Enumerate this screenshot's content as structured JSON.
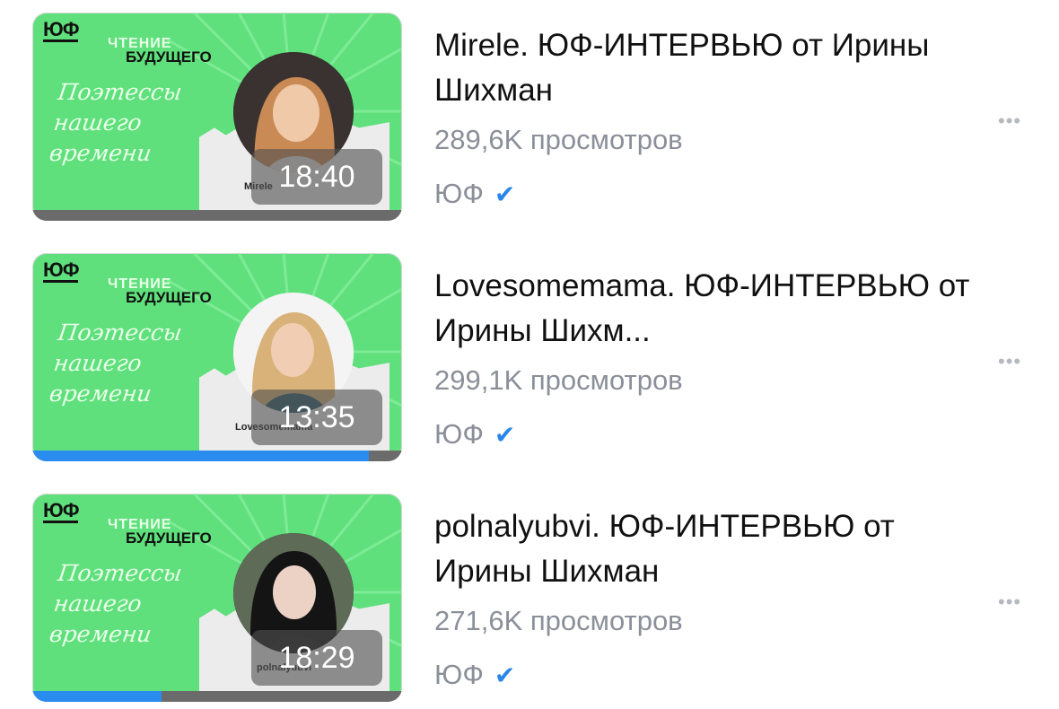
{
  "videos": [
    {
      "thumb": {
        "logo": "ЮФ",
        "header_line1": "ЧТЕНИЕ",
        "header_line2": "БУДУЩЕГО",
        "script_lines": [
          "Поэтессы",
          "нашего",
          "времени"
        ],
        "caption": "Mirele",
        "duration": "18:40",
        "progress": 0.0
      },
      "title": "Mirele. ЮФ-ИНТЕРВЬЮ от Ирины Шихман",
      "views": "289,6K просмотров",
      "channel": "ЮФ",
      "verified_icon": "checkmark-icon",
      "more_label": "•••"
    },
    {
      "thumb": {
        "logo": "ЮФ",
        "header_line1": "ЧТЕНИЕ",
        "header_line2": "БУДУЩЕГО",
        "script_lines": [
          "Поэтессы",
          "нашего",
          "времени"
        ],
        "caption": "Lovesomemama",
        "duration": "13:35",
        "progress": 0.91
      },
      "title": "Lovesomemama. ЮФ-ИНТЕРВЬЮ от Ирины Шихм...",
      "views": "299,1K просмотров",
      "channel": "ЮФ",
      "verified_icon": "checkmark-icon",
      "more_label": "•••"
    },
    {
      "thumb": {
        "logo": "ЮФ",
        "header_line1": "ЧТЕНИЕ",
        "header_line2": "БУДУЩЕГО",
        "script_lines": [
          "Поэтессы",
          "нашего",
          "времени"
        ],
        "caption": "polnalyubvi",
        "duration": "18:29",
        "progress": 0.35
      },
      "title": "polnalyubvi. ЮФ-ИНТЕРВЬЮ от Ирины Шихман",
      "views": "271,6K просмотров",
      "channel": "ЮФ",
      "verified_icon": "checkmark-icon",
      "more_label": "•••"
    }
  ],
  "colors": {
    "thumb_green": "#5fe07c",
    "progress_blue": "#2b8cf0",
    "meta_gray": "#8a8f99",
    "verified_blue": "#2a86e8"
  }
}
